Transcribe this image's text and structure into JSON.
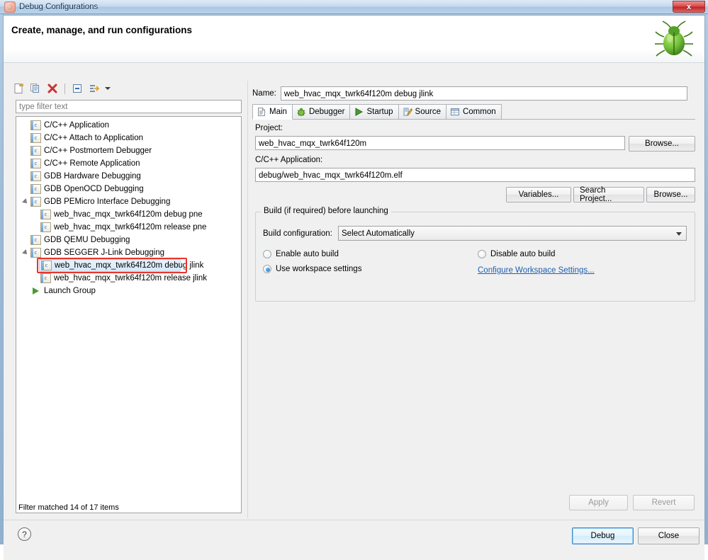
{
  "window": {
    "title": "Debug Configurations",
    "title_icon": "bug-icon",
    "close_label": "x"
  },
  "header": {
    "title": "Create, manage, and run configurations",
    "decor_icon": "green-bug-icon"
  },
  "left_panel": {
    "toolbar": [
      {
        "name": "new-configuration-icon",
        "label": "New"
      },
      {
        "name": "duplicate-configuration-icon",
        "label": "Duplicate"
      },
      {
        "name": "delete-configuration-icon",
        "label": "Delete"
      },
      {
        "name": "collapse-all-icon",
        "label": "Collapse All"
      },
      {
        "name": "filter-configurations-icon",
        "label": "Filter"
      }
    ],
    "filter": {
      "placeholder": "type filter text",
      "value": ""
    },
    "tree": [
      {
        "label": "C/C++ Application",
        "icon": "c-config-icon",
        "indent": 1,
        "expander": "none",
        "selected": false
      },
      {
        "label": "C/C++ Attach to Application",
        "icon": "c-config-icon",
        "indent": 1,
        "expander": "none",
        "selected": false
      },
      {
        "label": "C/C++ Postmortem Debugger",
        "icon": "c-config-icon",
        "indent": 1,
        "expander": "none",
        "selected": false
      },
      {
        "label": "C/C++ Remote Application",
        "icon": "c-config-icon",
        "indent": 1,
        "expander": "none",
        "selected": false
      },
      {
        "label": "GDB Hardware Debugging",
        "icon": "c-config-icon",
        "indent": 1,
        "expander": "none",
        "selected": false
      },
      {
        "label": "GDB OpenOCD Debugging",
        "icon": "c-config-icon",
        "indent": 1,
        "expander": "none",
        "selected": false
      },
      {
        "label": "GDB PEMicro Interface Debugging",
        "icon": "c-config-icon",
        "indent": 0,
        "expander": "expanded",
        "selected": false
      },
      {
        "label": "web_hvac_mqx_twrk64f120m debug pne",
        "icon": "c-config-icon",
        "indent": 2,
        "expander": "none",
        "selected": false
      },
      {
        "label": "web_hvac_mqx_twrk64f120m release pne",
        "icon": "c-config-icon",
        "indent": 2,
        "expander": "none",
        "selected": false
      },
      {
        "label": "GDB QEMU Debugging",
        "icon": "c-config-icon",
        "indent": 1,
        "expander": "none",
        "selected": false
      },
      {
        "label": "GDB SEGGER J-Link Debugging",
        "icon": "c-config-icon",
        "indent": 0,
        "expander": "expanded",
        "selected": false
      },
      {
        "label": "web_hvac_mqx_twrk64f120m debug jlink",
        "icon": "c-config-icon",
        "indent": 2,
        "expander": "none",
        "selected": true
      },
      {
        "label": "web_hvac_mqx_twrk64f120m release jlink",
        "icon": "c-config-icon",
        "indent": 2,
        "expander": "none",
        "selected": false
      },
      {
        "label": "Launch Group",
        "icon": "launch-group-icon",
        "indent": 1,
        "expander": "none",
        "selected": false
      }
    ],
    "status": "Filter matched 14 of 17 items"
  },
  "right_panel": {
    "name_label": "Name:",
    "name_value": "web_hvac_mqx_twrk64f120m debug jlink",
    "tabs": [
      {
        "label": "Main",
        "icon": "document-icon",
        "active": true
      },
      {
        "label": "Debugger",
        "icon": "debugger-bug-icon",
        "active": false
      },
      {
        "label": "Startup",
        "icon": "play-icon",
        "active": false
      },
      {
        "label": "Source",
        "icon": "source-edit-icon",
        "active": false
      },
      {
        "label": "Common",
        "icon": "common-window-icon",
        "active": false
      }
    ],
    "main_tab": {
      "project_label": "Project:",
      "project_value": "web_hvac_mqx_twrk64f120m",
      "project_browse_label": "Browse...",
      "application_label": "C/C++ Application:",
      "application_value": "debug/web_hvac_mqx_twrk64f120m.elf",
      "variables_label": "Variables...",
      "search_project_label": "Search Project...",
      "app_browse_label": "Browse...",
      "build_group_title": "Build (if required) before launching",
      "build_config_label": "Build configuration:",
      "build_config_value": "Select Automatically",
      "radio_enable_auto_build": {
        "label": "Enable auto build",
        "checked": false
      },
      "radio_disable_auto_build": {
        "label": "Disable auto build",
        "checked": false
      },
      "radio_use_workspace_settings": {
        "label": "Use workspace settings",
        "checked": true
      },
      "configure_workspace_link": "Configure Workspace Settings..."
    },
    "apply_label": "Apply",
    "revert_label": "Revert"
  },
  "footer": {
    "help_label": "?",
    "debug_label": "Debug",
    "close_label": "Close"
  },
  "colors": {
    "accent": "#1c5fb1",
    "annotation": "#e8352b",
    "selection": "#d6e9fa",
    "chrome": "#f0f0f0"
  }
}
